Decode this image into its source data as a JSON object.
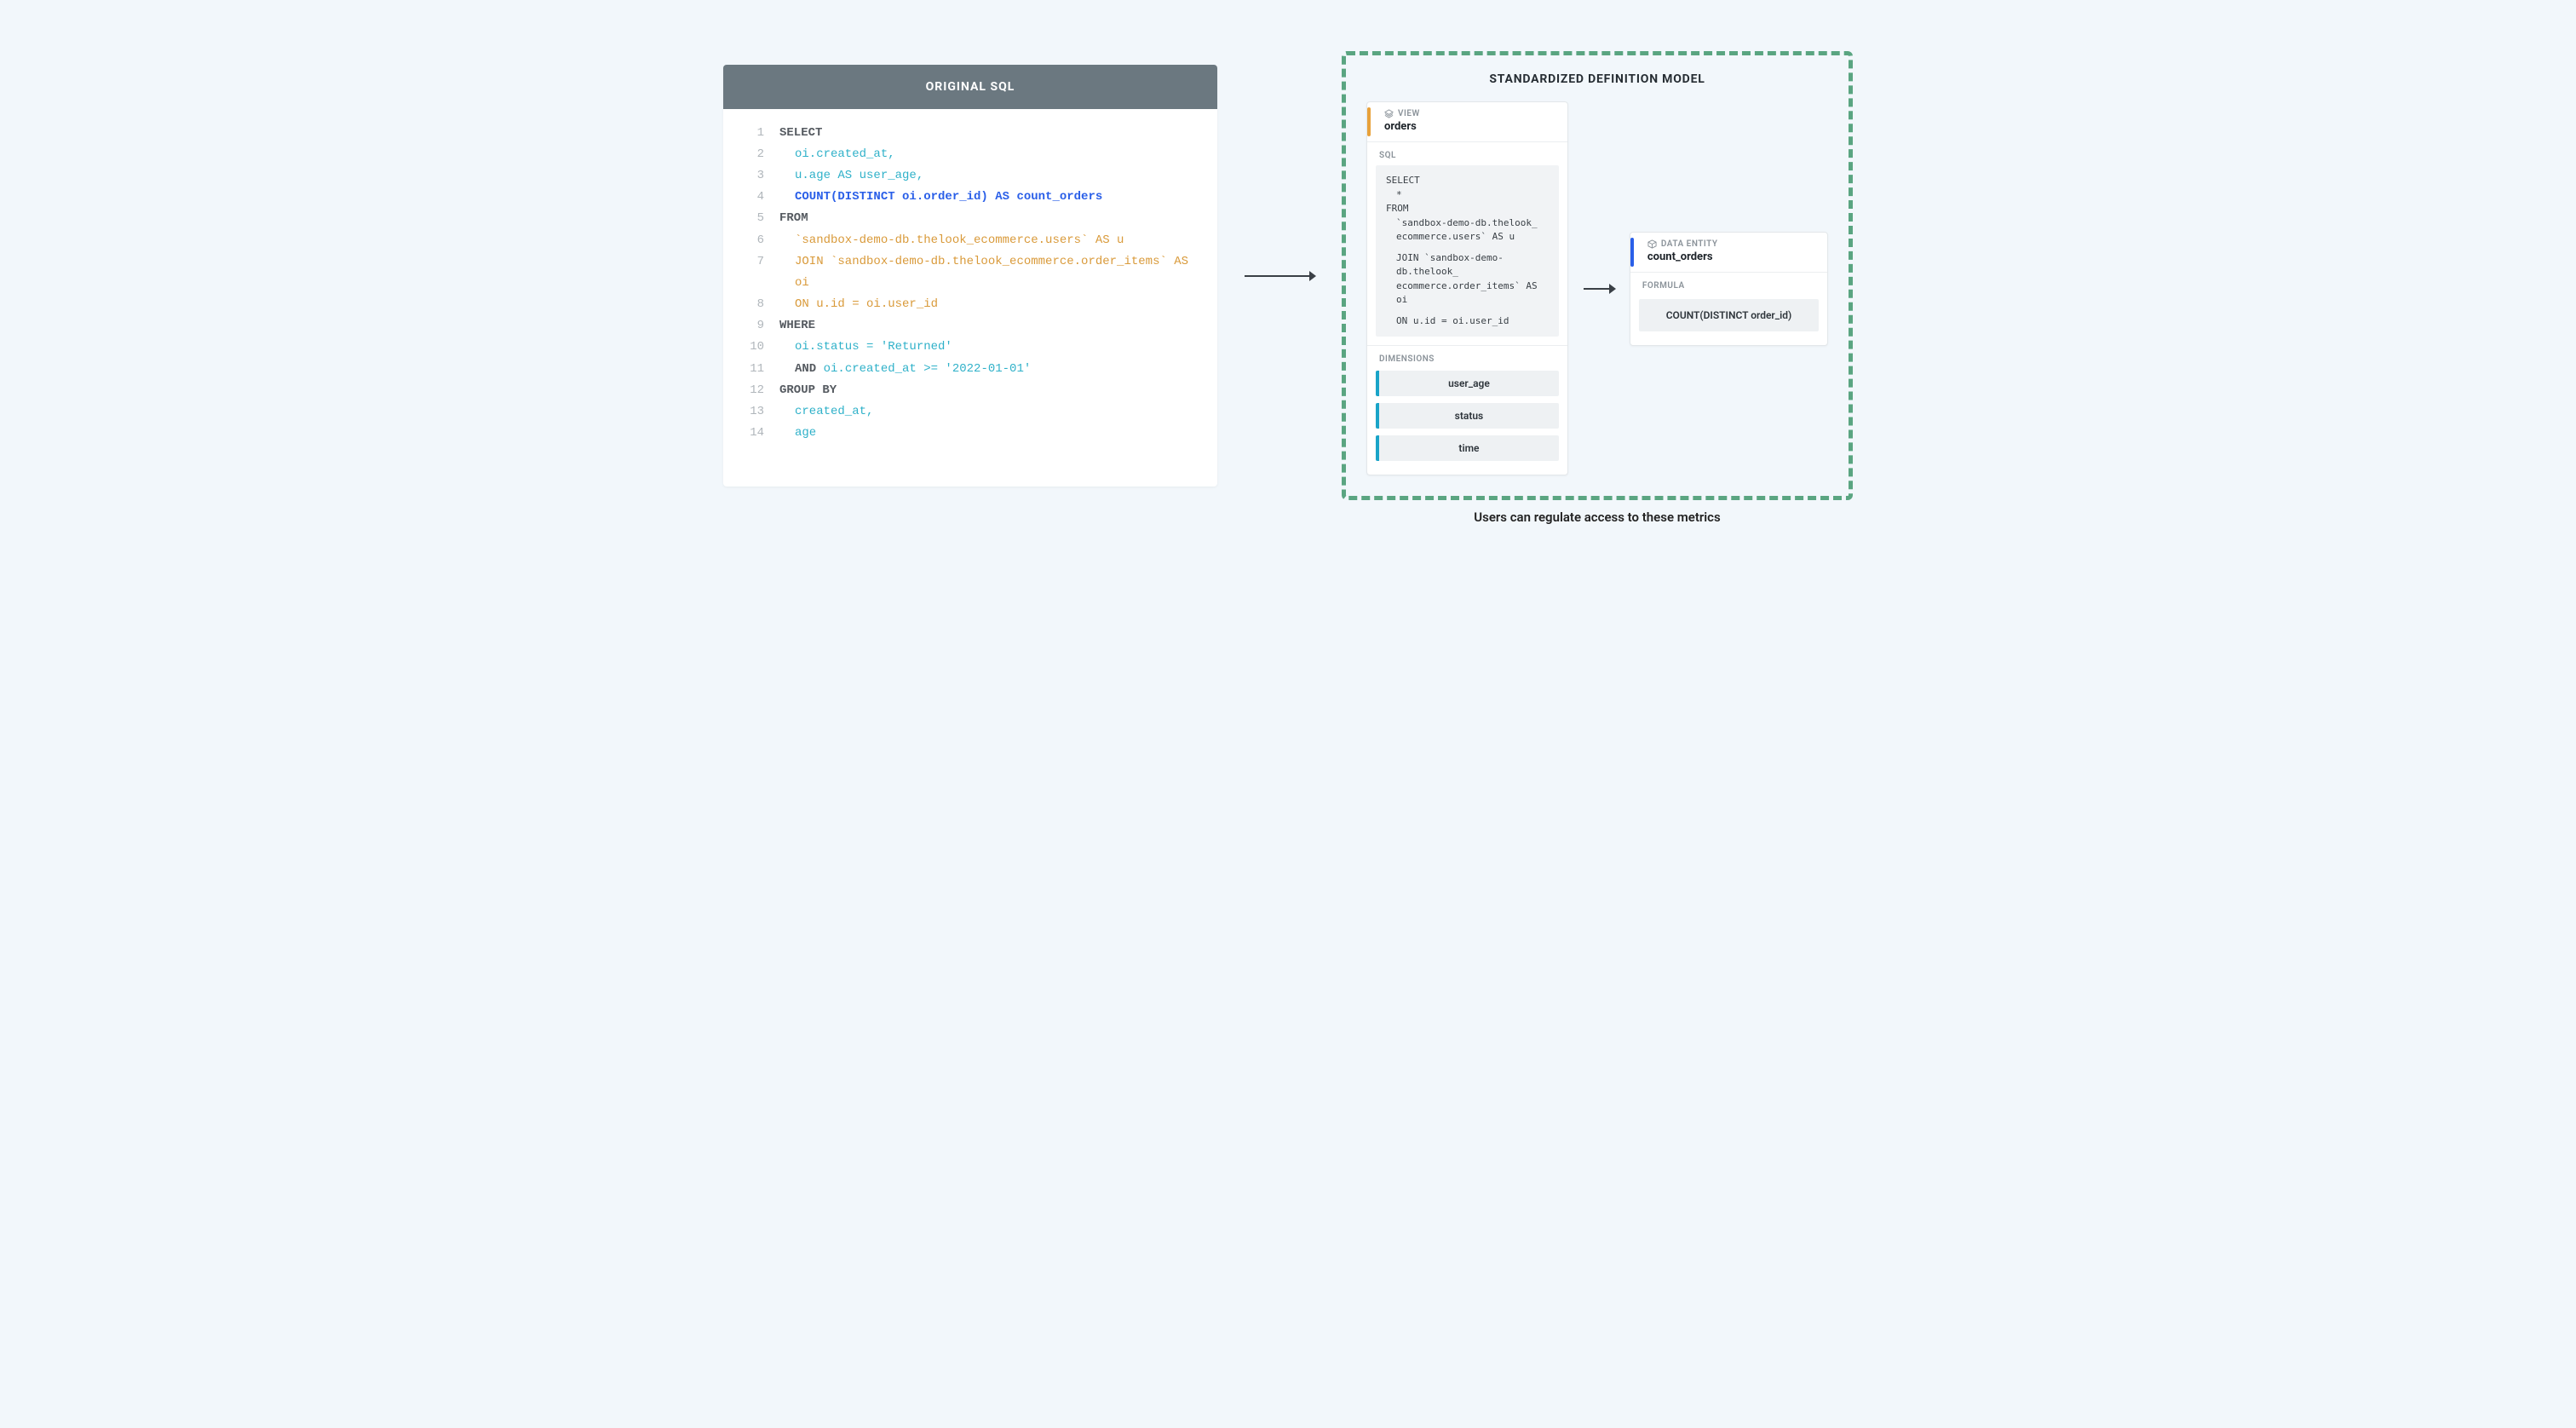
{
  "left": {
    "title": "ORIGINAL SQL",
    "lines": [
      {
        "n": "1",
        "segs": [
          {
            "t": "SELECT",
            "c": "kw"
          }
        ]
      },
      {
        "n": "2",
        "ind": 1,
        "segs": [
          {
            "t": "oi.created_at,",
            "c": "cyan"
          }
        ]
      },
      {
        "n": "3",
        "ind": 1,
        "segs": [
          {
            "t": "u.age AS user_age,",
            "c": "cyan"
          }
        ]
      },
      {
        "n": "4",
        "ind": 1,
        "segs": [
          {
            "t": "COUNT(DISTINCT oi.order_id) AS count_orders",
            "c": "blue"
          }
        ]
      },
      {
        "n": "5",
        "segs": [
          {
            "t": "FROM",
            "c": "kw"
          }
        ]
      },
      {
        "n": "6",
        "ind": 1,
        "segs": [
          {
            "t": "`sandbox-demo-db.thelook_ecommerce.users` AS u",
            "c": "orange"
          }
        ]
      },
      {
        "n": "7",
        "ind": 1,
        "segs": [
          {
            "t": "JOIN `sandbox-demo-db.thelook_ecommerce.order_items` AS oi",
            "c": "orange"
          }
        ]
      },
      {
        "n": "8",
        "ind": 1,
        "segs": [
          {
            "t": "ON u.id = oi.user_id",
            "c": "orange"
          }
        ]
      },
      {
        "n": "9",
        "segs": [
          {
            "t": "WHERE",
            "c": "kw"
          }
        ]
      },
      {
        "n": "10",
        "ind": 1,
        "segs": [
          {
            "t": "oi.status = 'Returned'",
            "c": "cyan"
          }
        ]
      },
      {
        "n": "11",
        "ind": 1,
        "segs": [
          {
            "t": "AND ",
            "c": "kw"
          },
          {
            "t": "oi.created_at >= '2022-01-01'",
            "c": "cyan"
          }
        ]
      },
      {
        "n": "12",
        "segs": [
          {
            "t": "GROUP BY",
            "c": "kw"
          }
        ]
      },
      {
        "n": "13",
        "ind": 1,
        "segs": [
          {
            "t": "created_at,",
            "c": "cyan"
          }
        ]
      },
      {
        "n": "14",
        "ind": 1,
        "segs": [
          {
            "t": "age",
            "c": "cyan"
          }
        ]
      }
    ]
  },
  "right": {
    "title": "STANDARDIZED DEFINITION MODEL",
    "caption": "Users can regulate access to these metrics",
    "view": {
      "label": "VIEW",
      "name": "orders",
      "sql_label": "SQL",
      "sql": {
        "l1": "SELECT",
        "l2": "*",
        "l3": "FROM",
        "l4": "`sandbox-demo-db.thelook_",
        "l5": "ecommerce.users` AS u",
        "l6": "JOIN `sandbox-demo-db.thelook_",
        "l7": "ecommerce.order_items` AS oi",
        "l8": "ON u.id = oi.user_id"
      },
      "dims_label": "DIMENSIONS",
      "dims": [
        "user_age",
        "status",
        "time"
      ]
    },
    "entity": {
      "label": "DATA ENTITY",
      "name": "count_orders",
      "formula_label": "FORMULA",
      "formula": "COUNT(DISTINCT order_id)"
    }
  }
}
